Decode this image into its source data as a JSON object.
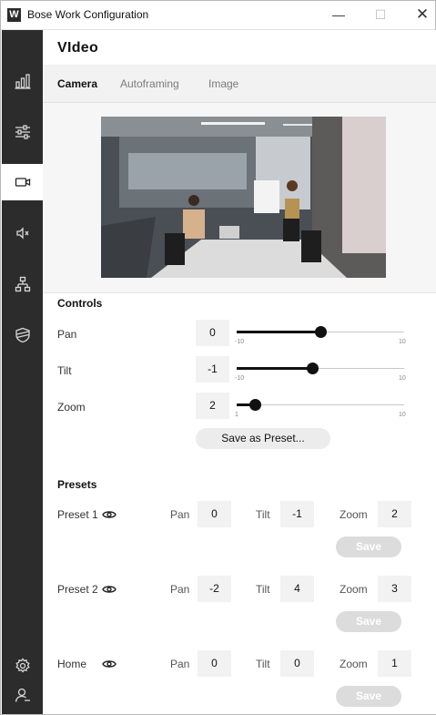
{
  "window": {
    "title": "Bose Work Configuration",
    "logo_letter": "W",
    "min_glyph": "—",
    "max_glyph": "☐",
    "close_glyph": "✕"
  },
  "sidebar": {
    "items": [
      {
        "icon": "bar-chart-icon",
        "active": false
      },
      {
        "icon": "sliders-icon",
        "active": false
      },
      {
        "icon": "video-camera-icon",
        "active": true
      },
      {
        "icon": "speaker-icon",
        "active": false
      },
      {
        "icon": "network-icon",
        "active": false
      },
      {
        "icon": "shield-icon",
        "active": false
      }
    ],
    "bottom": [
      {
        "icon": "gear-icon"
      },
      {
        "icon": "user-icon"
      }
    ]
  },
  "page": {
    "title": "VIdeo"
  },
  "tabs": [
    {
      "label": "Camera",
      "active": true
    },
    {
      "label": "Autoframing",
      "active": false
    },
    {
      "label": "Image",
      "active": false
    }
  ],
  "controls": {
    "title": "Controls",
    "pan": {
      "label": "Pan",
      "value": "0",
      "min": "-10",
      "max": "10",
      "fraction": 0.5
    },
    "tilt": {
      "label": "Tilt",
      "value": "-1",
      "min": "-10",
      "max": "10",
      "fraction": 0.45
    },
    "zoom": {
      "label": "Zoom",
      "value": "2",
      "min": "1",
      "max": "10",
      "fraction": 0.11
    },
    "save_preset_label": "Save as Preset..."
  },
  "presets": {
    "title": "Presets",
    "pan_label": "Pan",
    "tilt_label": "Tilt",
    "zoom_label": "Zoom",
    "items": [
      {
        "name": "Preset 1",
        "pan": "0",
        "tilt": "-1",
        "zoom": "2",
        "save_label": "Save"
      },
      {
        "name": "Preset 2",
        "pan": "-2",
        "tilt": "4",
        "zoom": "3",
        "save_label": "Save"
      },
      {
        "name": "Home",
        "pan": "0",
        "tilt": "0",
        "zoom": "1",
        "save_label": "Save"
      }
    ]
  }
}
